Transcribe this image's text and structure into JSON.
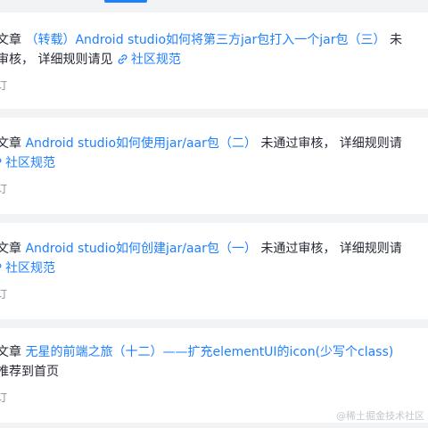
{
  "notifications": [
    {
      "prefix": "文章",
      "title": "（转载）Android studio如何将第三方jar包打入一个jar包（三）",
      "status": "未",
      "line2_prefix": "审核， 详细规则请见",
      "link_label": "社区规范",
      "meta": "订"
    },
    {
      "prefix": "文章",
      "title": "Android studio如何使用jar/aar包（二）",
      "status": "未通过审核， 详细规则请",
      "line2_prefix": "",
      "link_label": "社区规范",
      "meta": "订"
    },
    {
      "prefix": "文章",
      "title": "Android studio如何创建jar/aar包（一）",
      "status": "未通过审核， 详细规则请",
      "line2_prefix": "",
      "link_label": "社区规范",
      "meta": "订"
    },
    {
      "prefix": "文章",
      "title": "无星的前端之旅（十二）——扩充elementUI的icon(少写个class)",
      "status": "",
      "line2_prefix": "推荐到首页",
      "link_label": "",
      "meta": "订"
    }
  ],
  "watermark": "@稀土掘金技术社区",
  "colors": {
    "link": "#1e80ff",
    "text": "#252933",
    "meta": "#8a919f",
    "background": "#f2f3f5"
  }
}
